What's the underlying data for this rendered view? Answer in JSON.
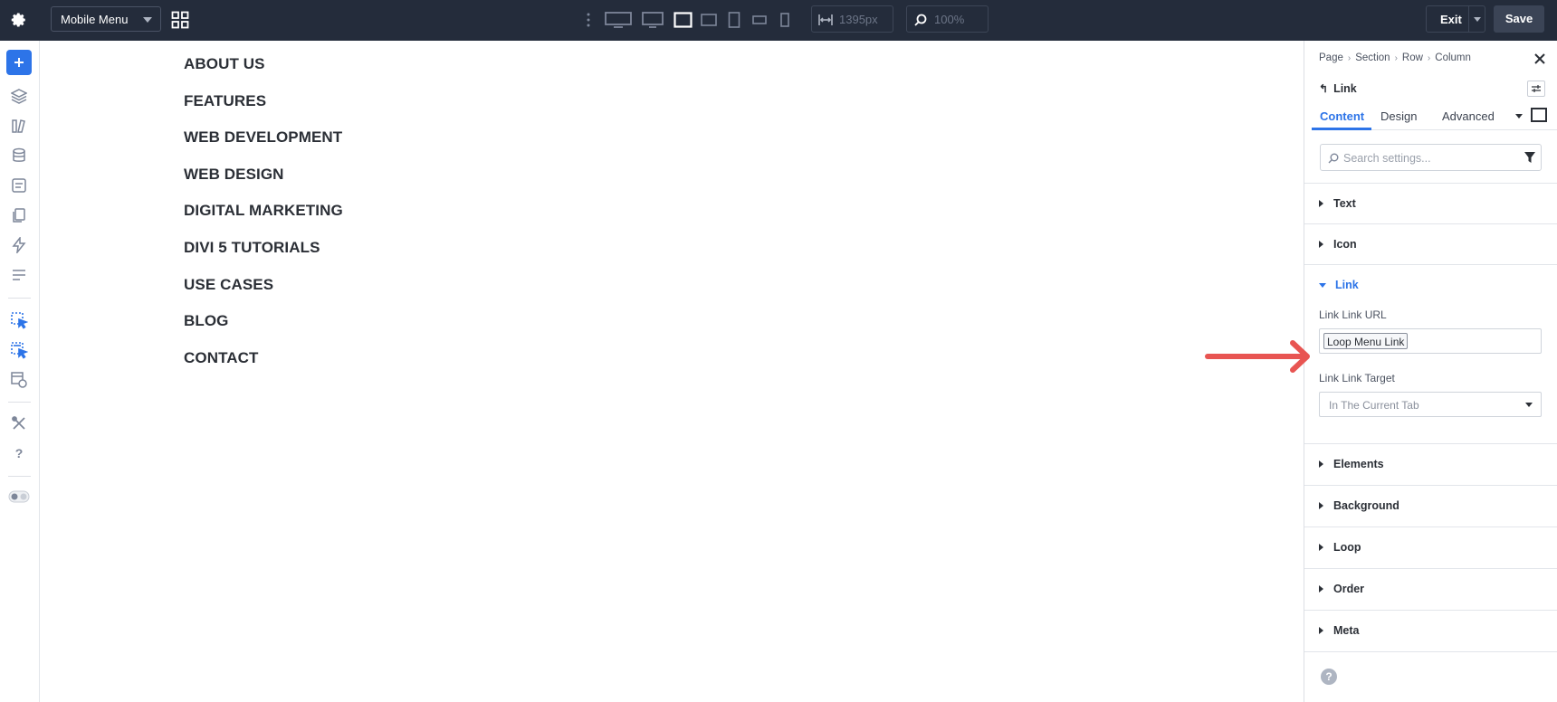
{
  "topbar": {
    "page_name": "Mobile Menu",
    "width_value": "1395px",
    "zoom_value": "100%",
    "exit_label": "Exit",
    "save_label": "Save",
    "breakpoint_icons": [
      "desktop-wide-icon",
      "desktop-icon",
      "laptop-icon",
      "tablet-landscape-icon",
      "tablet-icon",
      "phone-landscape-icon",
      "phone-icon"
    ]
  },
  "sidebar": {
    "icons": [
      "add-icon",
      "layers-icon",
      "library-icon",
      "database-icon",
      "forms-icon",
      "pages-icon",
      "lightning-icon",
      "list-icon",
      "interaction-icon",
      "interaction-alt-icon",
      "presets-icon",
      "tools-icon",
      "help-icon",
      "toggle-icon"
    ]
  },
  "canvas": {
    "menu_items": [
      "ABOUT US",
      "FEATURES",
      "WEB DEVELOPMENT",
      "WEB DESIGN",
      "DIGITAL MARKETING",
      "DIVI 5 TUTORIALS",
      "USE CASES",
      "BLOG",
      "CONTACT"
    ]
  },
  "panel": {
    "breadcrumbs": [
      "Page",
      "Section",
      "Row",
      "Column"
    ],
    "module_title": "Link",
    "tabs": [
      "Content",
      "Design",
      "Advanced"
    ],
    "search_placeholder": "Search settings...",
    "sections": {
      "text": "Text",
      "icon": "Icon",
      "link": "Link",
      "elements": "Elements",
      "background": "Background",
      "loop": "Loop",
      "order": "Order",
      "meta": "Meta"
    },
    "link_url_label": "Link Link URL",
    "link_url_value": "Loop Menu Link",
    "link_target_label": "Link Link Target",
    "link_target_value": "In The Current Tab"
  },
  "colors": {
    "topbar_bg": "#242c3b",
    "accent": "#2d74e8",
    "arrow": "#e85552"
  }
}
